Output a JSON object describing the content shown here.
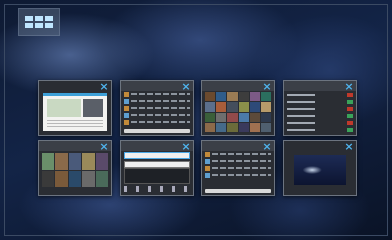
{
  "screen": {
    "name": "app-switcher",
    "switcher_button": {
      "icon": "grid-icon"
    }
  },
  "cards": [
    {
      "id": "web-page",
      "close_icon": "×"
    },
    {
      "id": "messages",
      "close_icon": "×"
    },
    {
      "id": "photo-grid",
      "close_icon": "×"
    },
    {
      "id": "settings-list",
      "close_icon": "×"
    },
    {
      "id": "media-library",
      "close_icon": "×"
    },
    {
      "id": "email-compose",
      "close_icon": "×"
    },
    {
      "id": "chat",
      "close_icon": "×"
    },
    {
      "id": "video",
      "close_icon": "×"
    }
  ],
  "colors": {
    "accent": "#4fb4ee",
    "card_bg": "#2a2d33",
    "card_border": "#6c7480"
  }
}
